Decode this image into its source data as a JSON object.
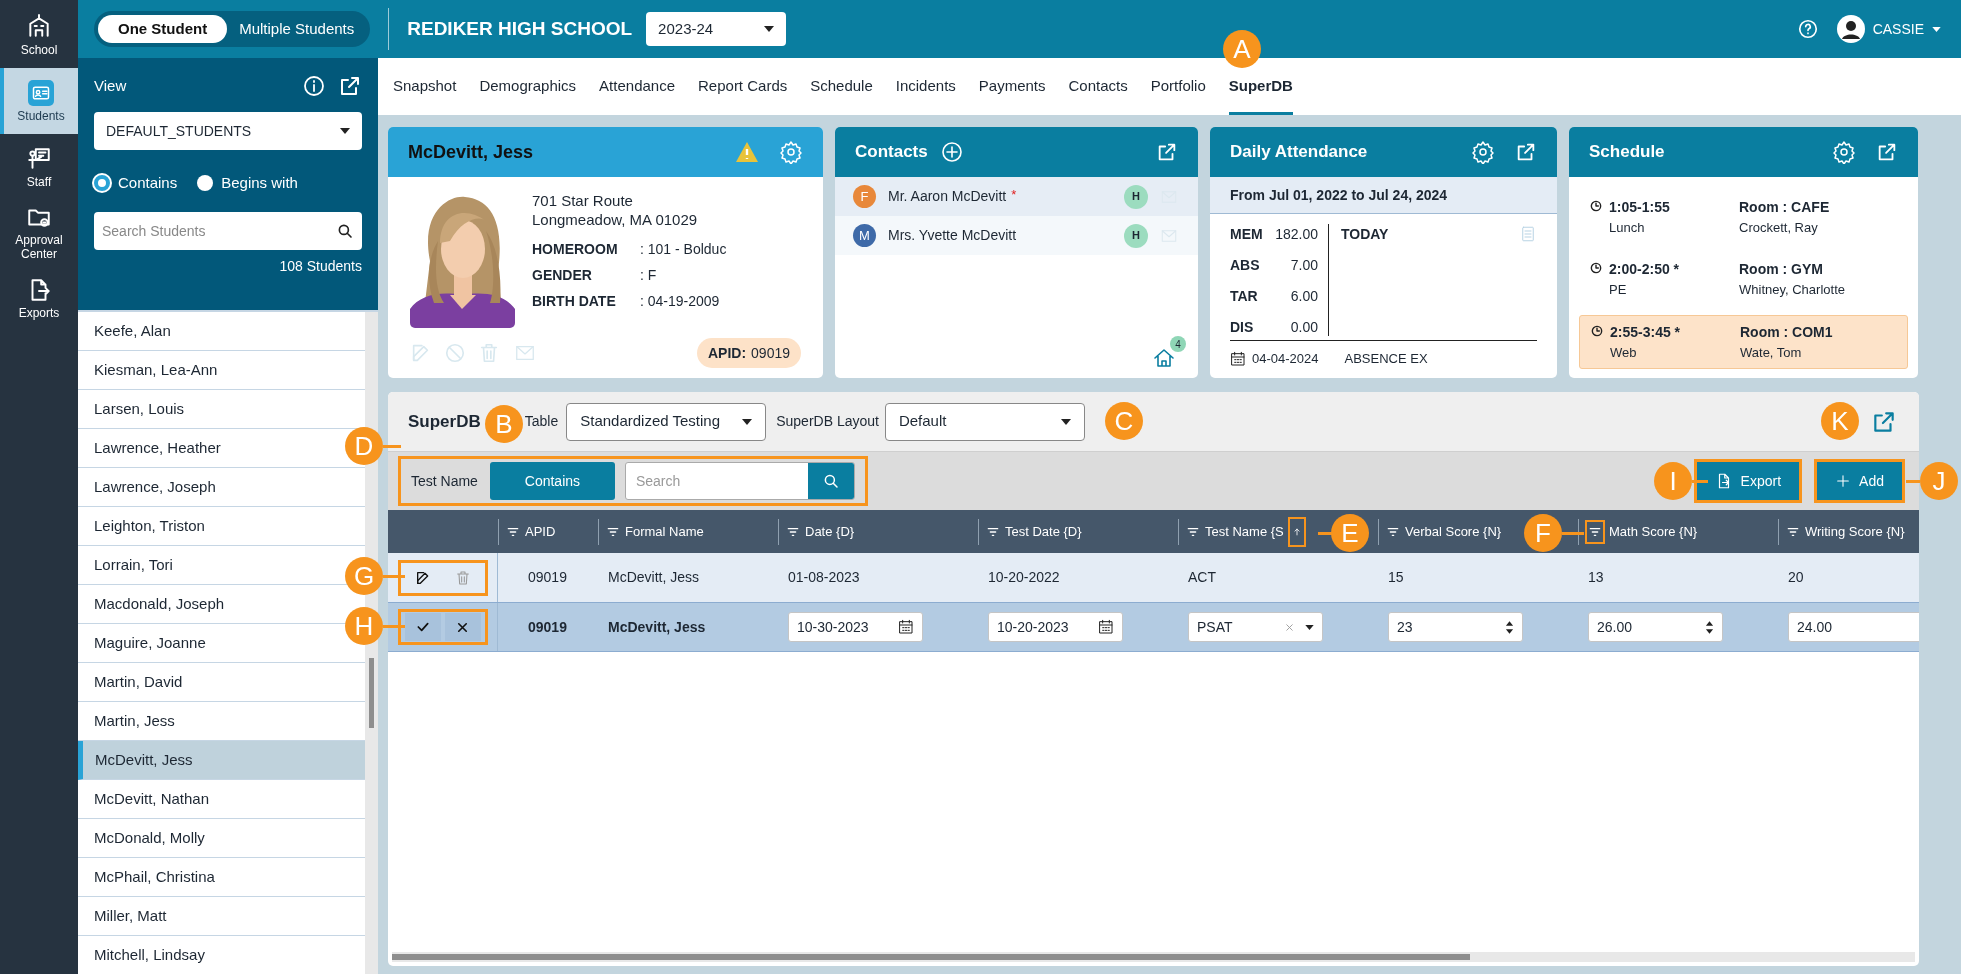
{
  "rail": [
    {
      "kind": "school",
      "label": "School",
      "selected": false
    },
    {
      "kind": "students",
      "label": "Students",
      "selected": true
    },
    {
      "kind": "staff",
      "label": "Staff",
      "selected": false
    },
    {
      "kind": "approval",
      "label": "Approval Center",
      "selected": false
    },
    {
      "kind": "exports",
      "label": "Exports",
      "selected": false
    }
  ],
  "top_bar": {
    "modes": [
      {
        "label": "One Student",
        "selected": true
      },
      {
        "label": "Multiple Students",
        "selected": false
      }
    ],
    "school": "REDIKER HIGH SCHOOL",
    "year": "2023-24",
    "user": "CASSIE"
  },
  "sidebar": {
    "view_label": "View",
    "view": "DEFAULT_STUDENTS",
    "match": [
      {
        "label": "Contains",
        "selected": true
      },
      {
        "label": "Begins with",
        "selected": false
      }
    ],
    "search_placeholder": "Search Students",
    "count": "108 Students",
    "students": [
      {
        "name": "Keefe, Alan",
        "selected": false
      },
      {
        "name": "Kiesman, Lea-Ann",
        "selected": false
      },
      {
        "name": "Larsen, Louis",
        "selected": false
      },
      {
        "name": "Lawrence, Heather",
        "selected": false
      },
      {
        "name": "Lawrence, Joseph",
        "selected": false
      },
      {
        "name": "Leighton, Triston",
        "selected": false
      },
      {
        "name": "Lorrain, Tori",
        "selected": false
      },
      {
        "name": "Macdonald, Joseph",
        "selected": false
      },
      {
        "name": "Maguire, Joanne",
        "selected": false
      },
      {
        "name": "Martin, David",
        "selected": false
      },
      {
        "name": "Martin, Jess",
        "selected": false
      },
      {
        "name": "McDevitt, Jess",
        "selected": true
      },
      {
        "name": "McDevitt, Nathan",
        "selected": false
      },
      {
        "name": "McDonald, Molly",
        "selected": false
      },
      {
        "name": "McPhail, Christina",
        "selected": false
      },
      {
        "name": "Miller, Matt",
        "selected": false
      },
      {
        "name": "Mitchell, Lindsay",
        "selected": false
      }
    ]
  },
  "tabs": [
    {
      "label": "Snapshot",
      "selected": false
    },
    {
      "label": "Demographics",
      "selected": false
    },
    {
      "label": "Attendance",
      "selected": false
    },
    {
      "label": "Report Cards",
      "selected": false
    },
    {
      "label": "Schedule",
      "selected": false
    },
    {
      "label": "Incidents",
      "selected": false
    },
    {
      "label": "Payments",
      "selected": false
    },
    {
      "label": "Contacts",
      "selected": false
    },
    {
      "label": "Portfolio",
      "selected": false
    },
    {
      "label": "SuperDB",
      "selected": true
    }
  ],
  "student_card": {
    "name": "McDevitt, Jess",
    "address": [
      "701 Star Route",
      "Longmeadow, MA 01029"
    ],
    "fields": [
      {
        "label": "HOMEROOM",
        "value": ": 101 - Bolduc"
      },
      {
        "label": "GENDER",
        "value": ": F"
      },
      {
        "label": "BIRTH DATE",
        "value": ": 04-19-2009"
      }
    ],
    "apid_label": "APID:",
    "apid": "09019"
  },
  "contacts_card": {
    "title": "Contacts",
    "contacts": [
      {
        "initial": "F",
        "color": "#e8883a",
        "name": "Mr. Aaron McDevitt",
        "marker": "*",
        "badge": "H"
      },
      {
        "initial": "M",
        "color": "#3e6aa8",
        "name": "Mrs. Yvette McDevitt",
        "badge": "H"
      }
    ],
    "household_count": "4"
  },
  "attendance_card": {
    "title": "Daily Attendance",
    "range": "From Jul 01, 2022 to Jul 24, 2024",
    "stats": [
      {
        "label": "MEM",
        "value": "182.00"
      },
      {
        "label": "ABS",
        "value": "7.00"
      },
      {
        "label": "TAR",
        "value": "6.00"
      },
      {
        "label": "DIS",
        "value": "0.00"
      }
    ],
    "today": "TODAY",
    "date": "04-04-2024",
    "code": "ABSENCE EX"
  },
  "schedule_card": {
    "title": "Schedule",
    "periods": [
      {
        "time": "1:05-1:55",
        "course": "Lunch",
        "room": "Room : CAFE",
        "teacher": "Crockett, Ray",
        "selected": false
      },
      {
        "time": "2:00-2:50 *",
        "course": "PE",
        "room": "Room : GYM",
        "teacher": "Whitney, Charlotte",
        "selected": false
      },
      {
        "time": "2:55-3:45 *",
        "course": "Web",
        "room": "Room : COM1",
        "teacher": "Wate, Tom",
        "selected": true
      }
    ]
  },
  "superdb": {
    "title": "SuperDB",
    "table_label": "Table",
    "table": "Standardized Testing",
    "layout_label": "SuperDB Layout",
    "layout": "Default",
    "filter": {
      "field": "Test Name",
      "mode": "Contains",
      "placeholder": "Search",
      "outlined": true
    },
    "buttons": [
      {
        "kind": "export",
        "label": "Export",
        "outlined": true
      },
      {
        "kind": "add",
        "label": "Add",
        "outlined": true
      }
    ],
    "columns": [
      {
        "label": "APID"
      },
      {
        "label": "Formal Name"
      },
      {
        "label": "Date {D}"
      },
      {
        "label": "Test Date {D}"
      },
      {
        "label": "Test Name {S",
        "sorted": true,
        "outlined": true
      },
      {
        "label": "Verbal Score {N}"
      },
      {
        "label": "Math Score {N}",
        "outlined": true
      },
      {
        "label": "Writing Score {N}"
      }
    ],
    "rows": [
      {
        "kind": "view",
        "outlined": true,
        "cells": [
          "09019",
          "McDevitt, Jess",
          "01-08-2023",
          "10-20-2022",
          "ACT",
          "15",
          "13",
          "20"
        ]
      },
      {
        "kind": "edit",
        "outlined": true,
        "cells": [
          {
            "kind": "text",
            "value": "09019"
          },
          {
            "kind": "text",
            "value": "McDevitt, Jess"
          },
          {
            "kind": "date",
            "value": "10-30-2023"
          },
          {
            "kind": "date",
            "value": "10-20-2023"
          },
          {
            "kind": "select",
            "value": "PSAT"
          },
          {
            "kind": "number",
            "value": "23"
          },
          {
            "kind": "number",
            "value": "26.00"
          },
          {
            "kind": "number",
            "value": "24.00"
          }
        ]
      }
    ]
  },
  "annotations": [
    "A",
    "B",
    "C",
    "D",
    "E",
    "F",
    "G",
    "H",
    "I",
    "J",
    "K"
  ]
}
